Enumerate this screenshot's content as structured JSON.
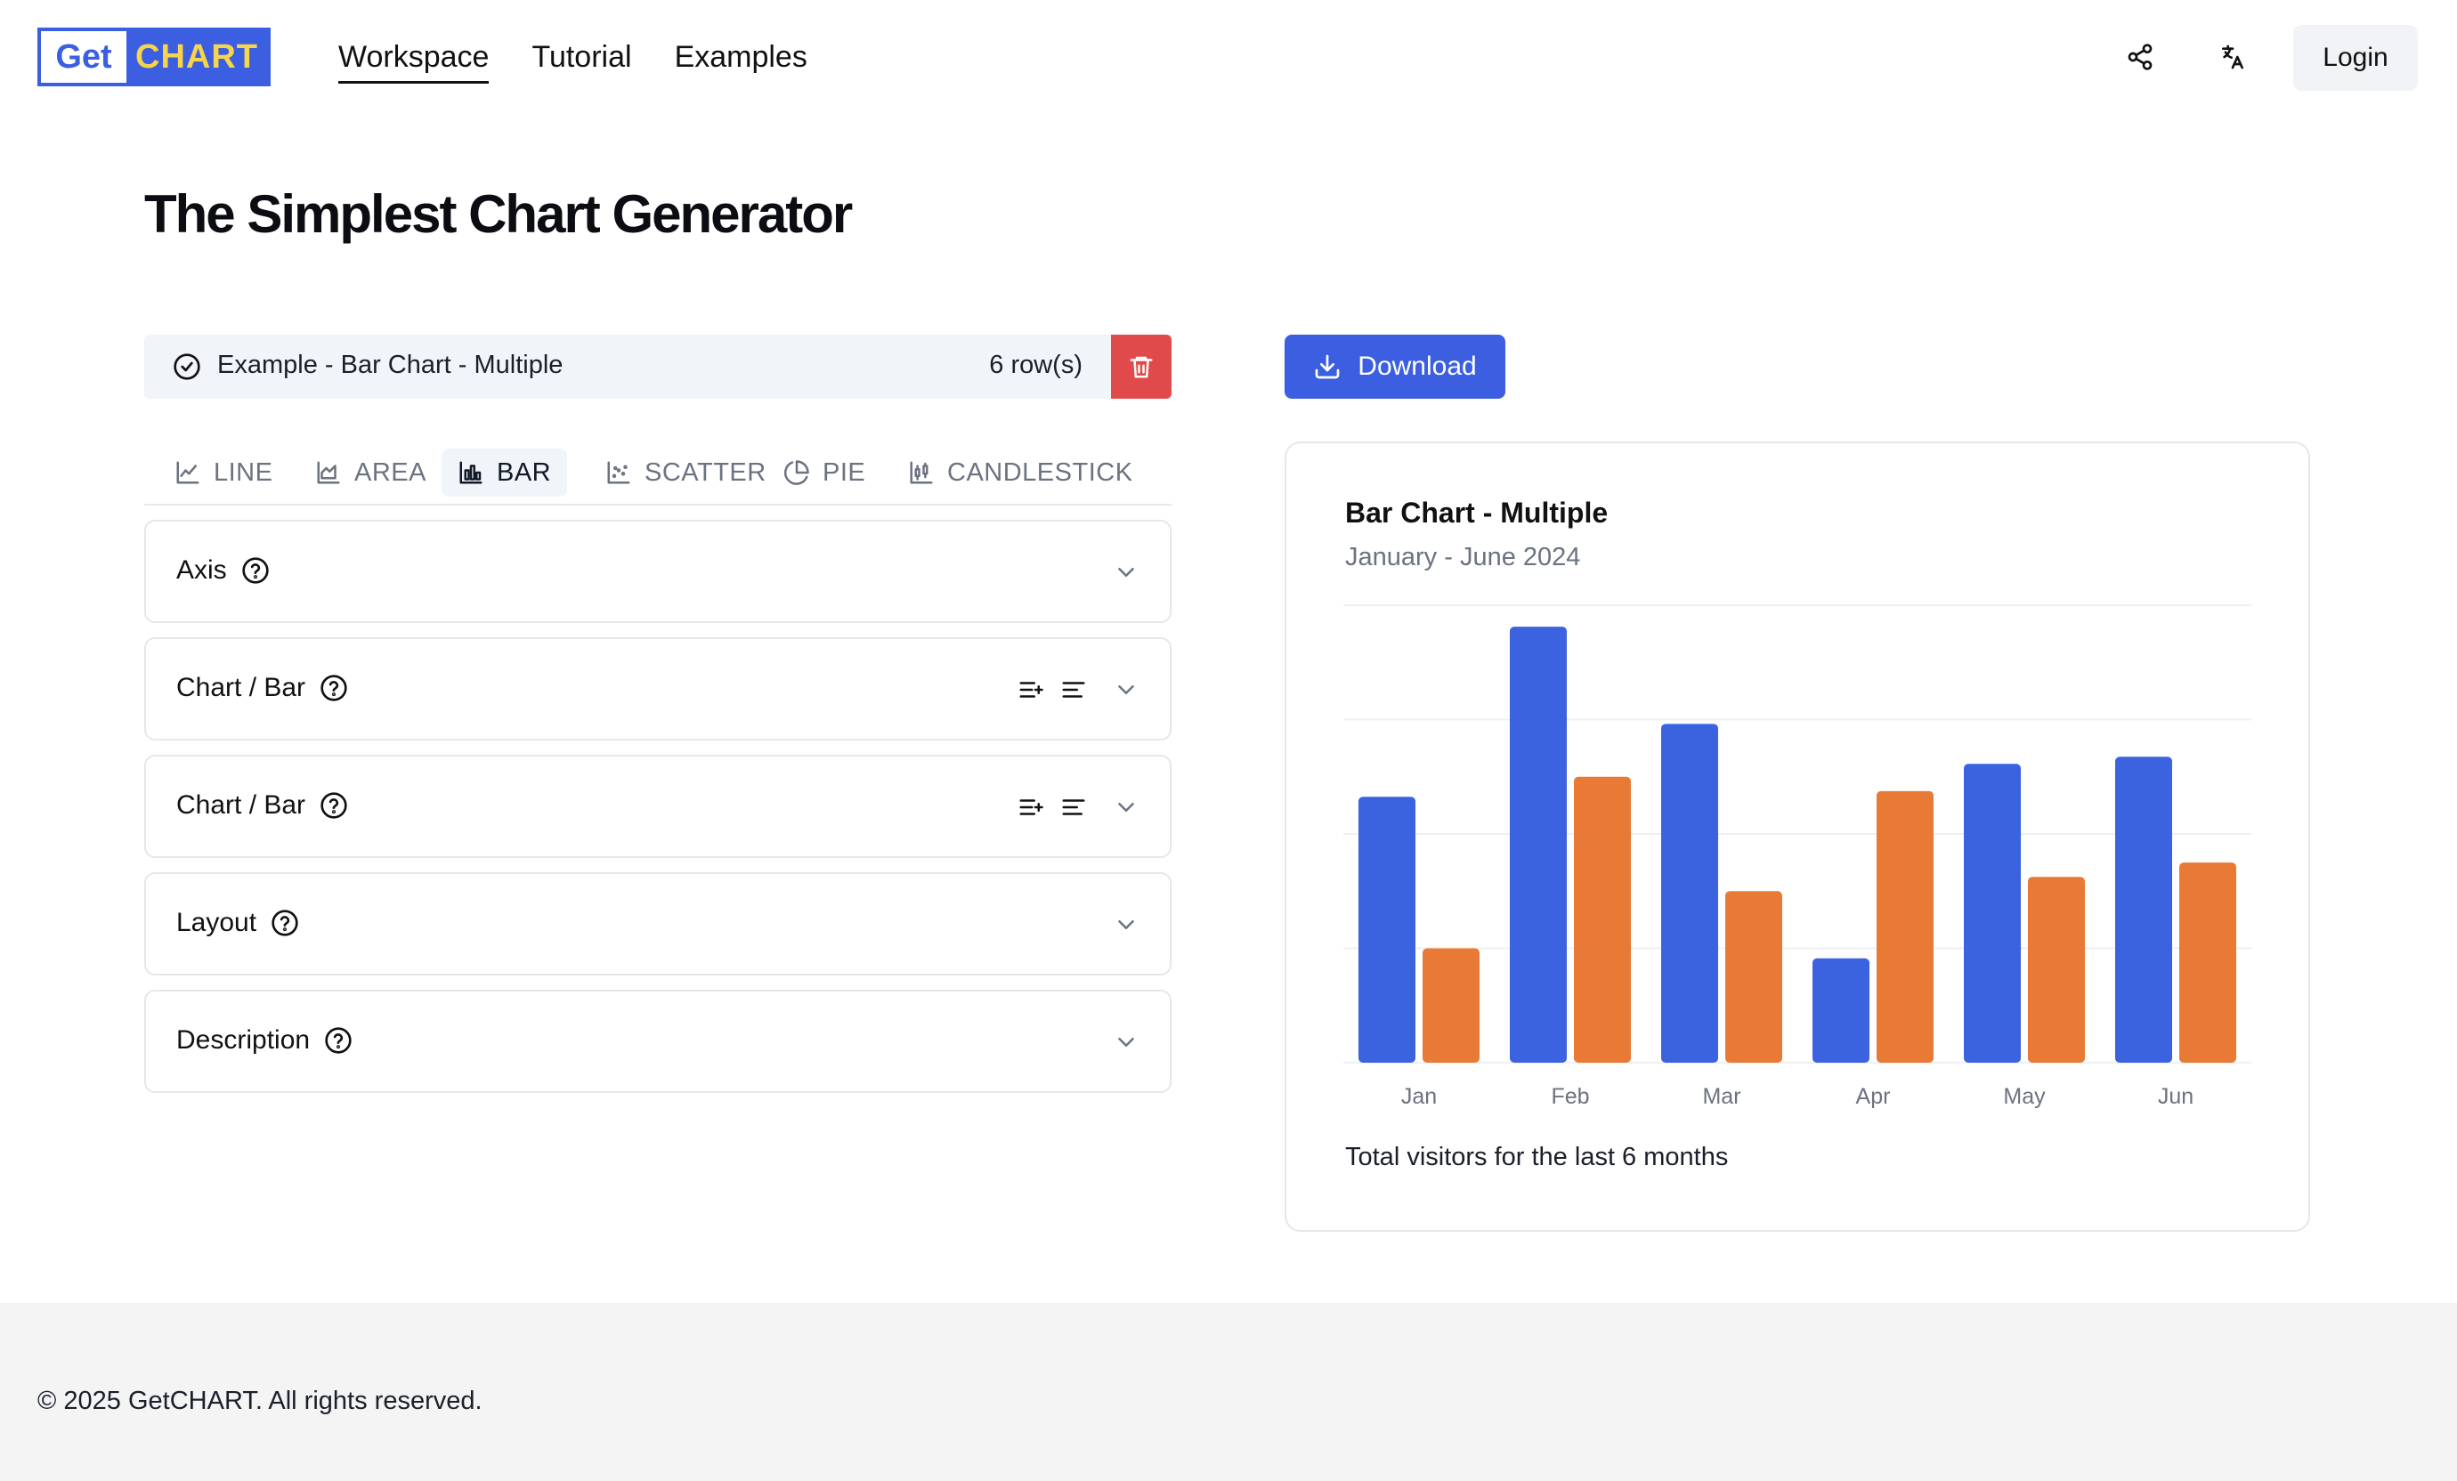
{
  "logo": {
    "part1": "Get",
    "part2": "CHART"
  },
  "nav": {
    "workspace": "Workspace",
    "tutorial": "Tutorial",
    "examples": "Examples"
  },
  "header": {
    "login": "Login",
    "share_icon": "share-icon",
    "translate_icon": "translate-icon"
  },
  "page": {
    "title": "The Simplest Chart Generator"
  },
  "dataset": {
    "name": "Example - Bar Chart - Multiple",
    "rows": "6 row(s)"
  },
  "tabs": [
    {
      "label": "LINE",
      "icon": "line-chart-icon"
    },
    {
      "label": "AREA",
      "icon": "area-chart-icon"
    },
    {
      "label": "BAR",
      "icon": "bar-chart-icon",
      "active": true
    },
    {
      "label": "SCATTER",
      "icon": "scatter-chart-icon"
    },
    {
      "label": "PIE",
      "icon": "pie-chart-icon"
    },
    {
      "label": "CANDLESTICK",
      "icon": "candlestick-chart-icon"
    }
  ],
  "accordions": [
    {
      "label": "Axis"
    },
    {
      "label": "Chart / Bar"
    },
    {
      "label": "Chart / Bar"
    },
    {
      "label": "Layout"
    },
    {
      "label": "Description"
    }
  ],
  "download": {
    "label": "Download"
  },
  "chart_data": {
    "type": "bar",
    "title": "Bar Chart - Multiple",
    "subtitle": "January - June 2024",
    "categories": [
      "Jan",
      "Feb",
      "Mar",
      "Apr",
      "May",
      "Jun"
    ],
    "series": [
      {
        "values": [
          186,
          305,
          237,
          73,
          209,
          214
        ],
        "color": "#3b63e0"
      },
      {
        "values": [
          80,
          200,
          120,
          190,
          130,
          140
        ],
        "color": "#e87a36"
      }
    ],
    "ylim": [
      0,
      320
    ],
    "grid": true,
    "footer": "Total visitors for the last 6 months"
  },
  "footer": {
    "text": "© 2025 GetCHART. All rights reserved."
  }
}
